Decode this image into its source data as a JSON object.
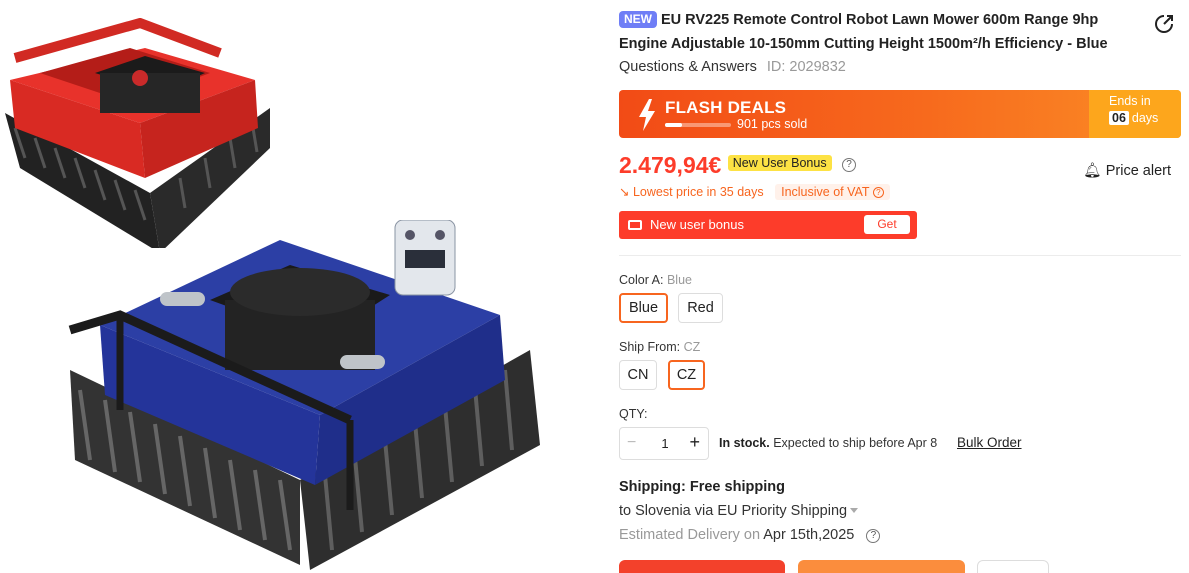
{
  "product": {
    "badge": "NEW",
    "title": "EU RV225 Remote Control Robot Lawn Mower 600m Range 9hp Engine Adjustable 10-150mm Cutting Height 1500m²/h Efficiency - Blue",
    "qa_link": "Questions & Answers",
    "id_text": "ID: 2029832"
  },
  "flash": {
    "title": "FLASH DEALS",
    "sold": "901 pcs sold",
    "sold_progress": 0.25,
    "ends_label": "Ends in",
    "days_value": "06",
    "days_unit": "days"
  },
  "price": {
    "value": "2.479,94€",
    "new_user_badge": "New User Bonus",
    "alert": "Price alert",
    "lowest": "Lowest price in 35 days",
    "vat": "Inclusive of VAT"
  },
  "bonus": {
    "label": "New user bonus",
    "button": "Get"
  },
  "color": {
    "label": "Color A:",
    "selected": "Blue",
    "options": [
      "Blue",
      "Red"
    ]
  },
  "ship_from": {
    "label": "Ship From:",
    "selected": "CZ",
    "options": [
      "CN",
      "CZ"
    ]
  },
  "qty": {
    "label": "QTY:",
    "value": "1",
    "minus": "−",
    "plus": "+",
    "stock": "In stock.",
    "expected": "Expected to ship before Apr 8",
    "bulk": "Bulk Order"
  },
  "shipping": {
    "title": "Shipping: Free shipping",
    "via": "to Slovenia via EU Priority Shipping",
    "est_label": "Estimated Delivery on",
    "est_date": "Apr 15th,2025"
  },
  "colors": {
    "accent": "#f7651f",
    "price": "#fd3c2a",
    "badge": "#6f7ef6"
  }
}
